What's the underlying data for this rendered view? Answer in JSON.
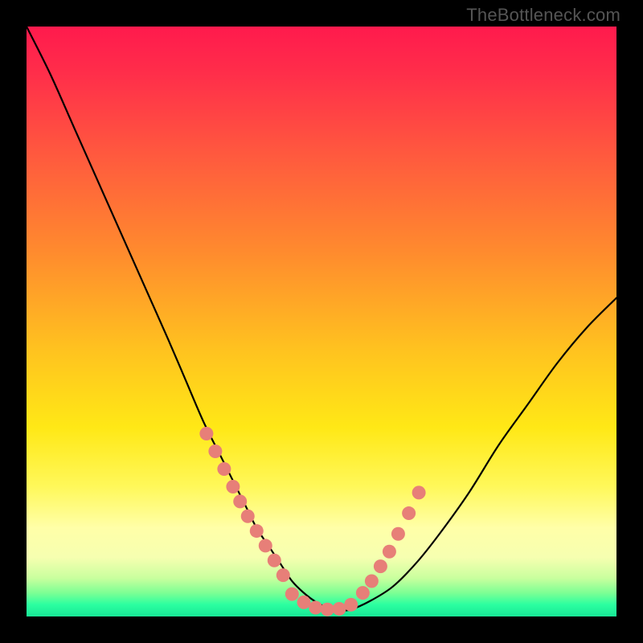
{
  "watermark": "TheBottleneck.com",
  "chart_data": {
    "type": "line",
    "title": "",
    "xlabel": "",
    "ylabel": "",
    "xlim": [
      0,
      100
    ],
    "ylim": [
      0,
      100
    ],
    "series": [
      {
        "name": "bottleneck-curve",
        "x": [
          0,
          4,
          8,
          12,
          16,
          20,
          24,
          27,
          30,
          33,
          35,
          37,
          39,
          41,
          43,
          45,
          47,
          49,
          51,
          53,
          55,
          58,
          62,
          66,
          70,
          75,
          80,
          85,
          90,
          95,
          100
        ],
        "y": [
          100,
          92,
          83,
          74,
          65,
          56,
          47,
          40,
          33,
          27,
          23,
          19,
          15,
          12,
          9,
          6,
          4,
          2.5,
          1.5,
          1,
          1.2,
          2.5,
          5,
          9,
          14,
          21,
          29,
          36,
          43,
          49,
          54
        ]
      }
    ],
    "markers": {
      "name": "highlighted-points",
      "color": "#e77f78",
      "left_cluster": {
        "x": [
          30.5,
          32,
          33.5,
          35,
          36.2,
          37.5,
          39,
          40.5,
          42,
          43.5
        ],
        "y": [
          31,
          28,
          25,
          22,
          19.5,
          17,
          14.5,
          12,
          9.5,
          7
        ]
      },
      "bottom_cluster": {
        "x": [
          45,
          47,
          49,
          51,
          53,
          55
        ],
        "y": [
          3.8,
          2.4,
          1.5,
          1.2,
          1.3,
          2.0
        ]
      },
      "right_cluster": {
        "x": [
          57,
          58.5,
          60,
          61.5,
          63,
          64.8,
          66.5
        ],
        "y": [
          4,
          6,
          8.5,
          11,
          14,
          17.5,
          21
        ]
      }
    }
  }
}
